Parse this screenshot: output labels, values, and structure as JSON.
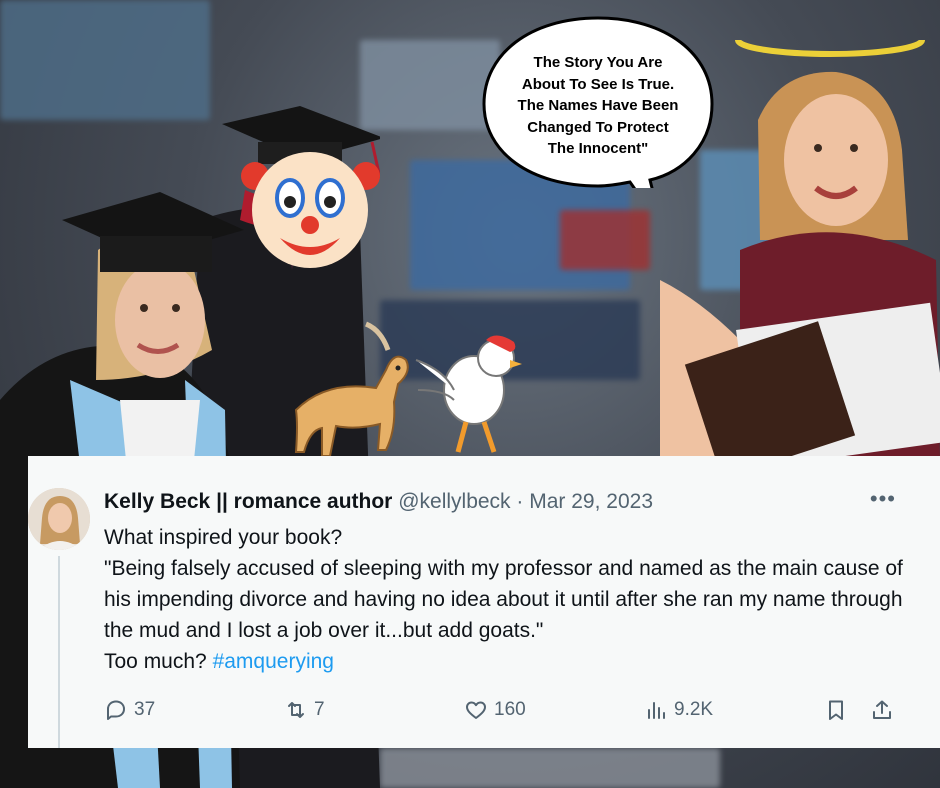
{
  "bubble": {
    "lines": [
      "The Story You Are",
      "About To See Is True.",
      "The Names Have Been",
      "Changed To Protect",
      "The Innocent\""
    ]
  },
  "tweet": {
    "author_name": "Kelly Beck || romance author",
    "handle": "@kellylbeck",
    "separator": "·",
    "date": "Mar 29, 2023",
    "more_label": "•••",
    "body_line1": "What inspired your book?",
    "body_quote": "\"Being falsely accused of sleeping with my professor and named as the main cause of his impending divorce and having no idea about it until after she ran my name through the mud and I lost a job over it...but add goats.\"",
    "body_last_prefix": "Too much? ",
    "hashtag": "#amquerying",
    "actions": {
      "replies": "37",
      "reposts": "7",
      "likes": "160",
      "views": "9.2K"
    },
    "icons": [
      "reply-icon",
      "repost-icon",
      "like-icon",
      "views-icon",
      "bookmark-icon",
      "share-icon"
    ]
  },
  "colors": {
    "link": "#1d9bf0",
    "muted": "#536471",
    "text": "#0f1419",
    "card": "#f7f9f9"
  }
}
